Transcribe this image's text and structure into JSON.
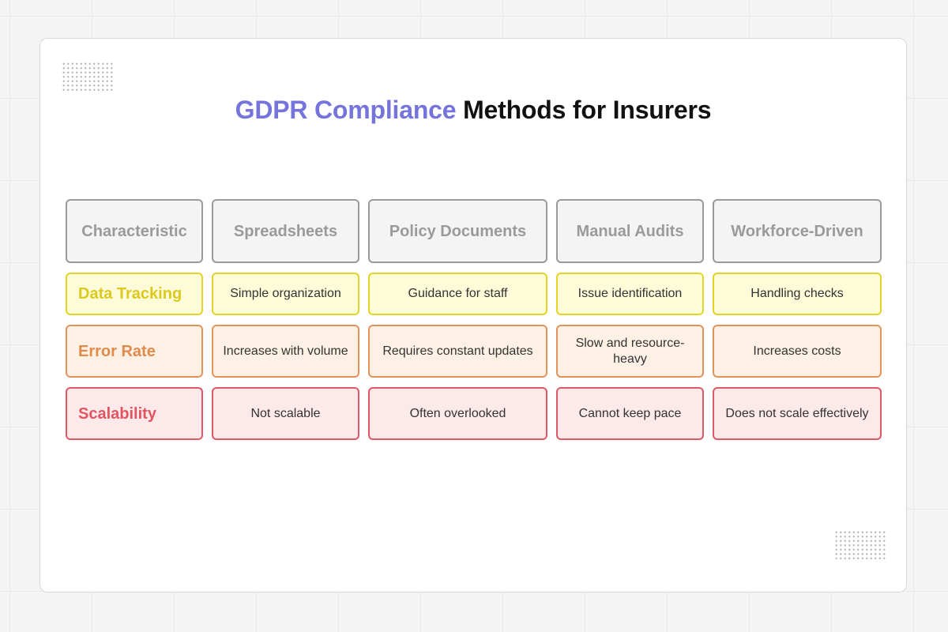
{
  "title": {
    "accent": "GDPR Compliance",
    "rest": "Methods for Insurers"
  },
  "colors": {
    "accent": "#7474dc",
    "header_border": "#9a9a9a",
    "data_tracking": "#e5d426",
    "error_rate": "#e2935a",
    "scalability": "#de5966"
  },
  "table": {
    "headers": [
      "Characteristic",
      "Spreadsheets",
      "Policy Documents",
      "Manual Audits",
      "Workforce-Driven"
    ],
    "rows": [
      {
        "label": "Data Tracking",
        "cells": [
          "Simple organization",
          "Guidance for staff",
          "Issue identification",
          "Handling checks"
        ]
      },
      {
        "label": "Error Rate",
        "cells": [
          "Increases with volume",
          "Requires constant updates",
          "Slow and resource-heavy",
          "Increases costs"
        ]
      },
      {
        "label": "Scalability",
        "cells": [
          "Not scalable",
          "Often overlooked",
          "Cannot keep pace",
          "Does not scale effectively"
        ]
      }
    ]
  }
}
